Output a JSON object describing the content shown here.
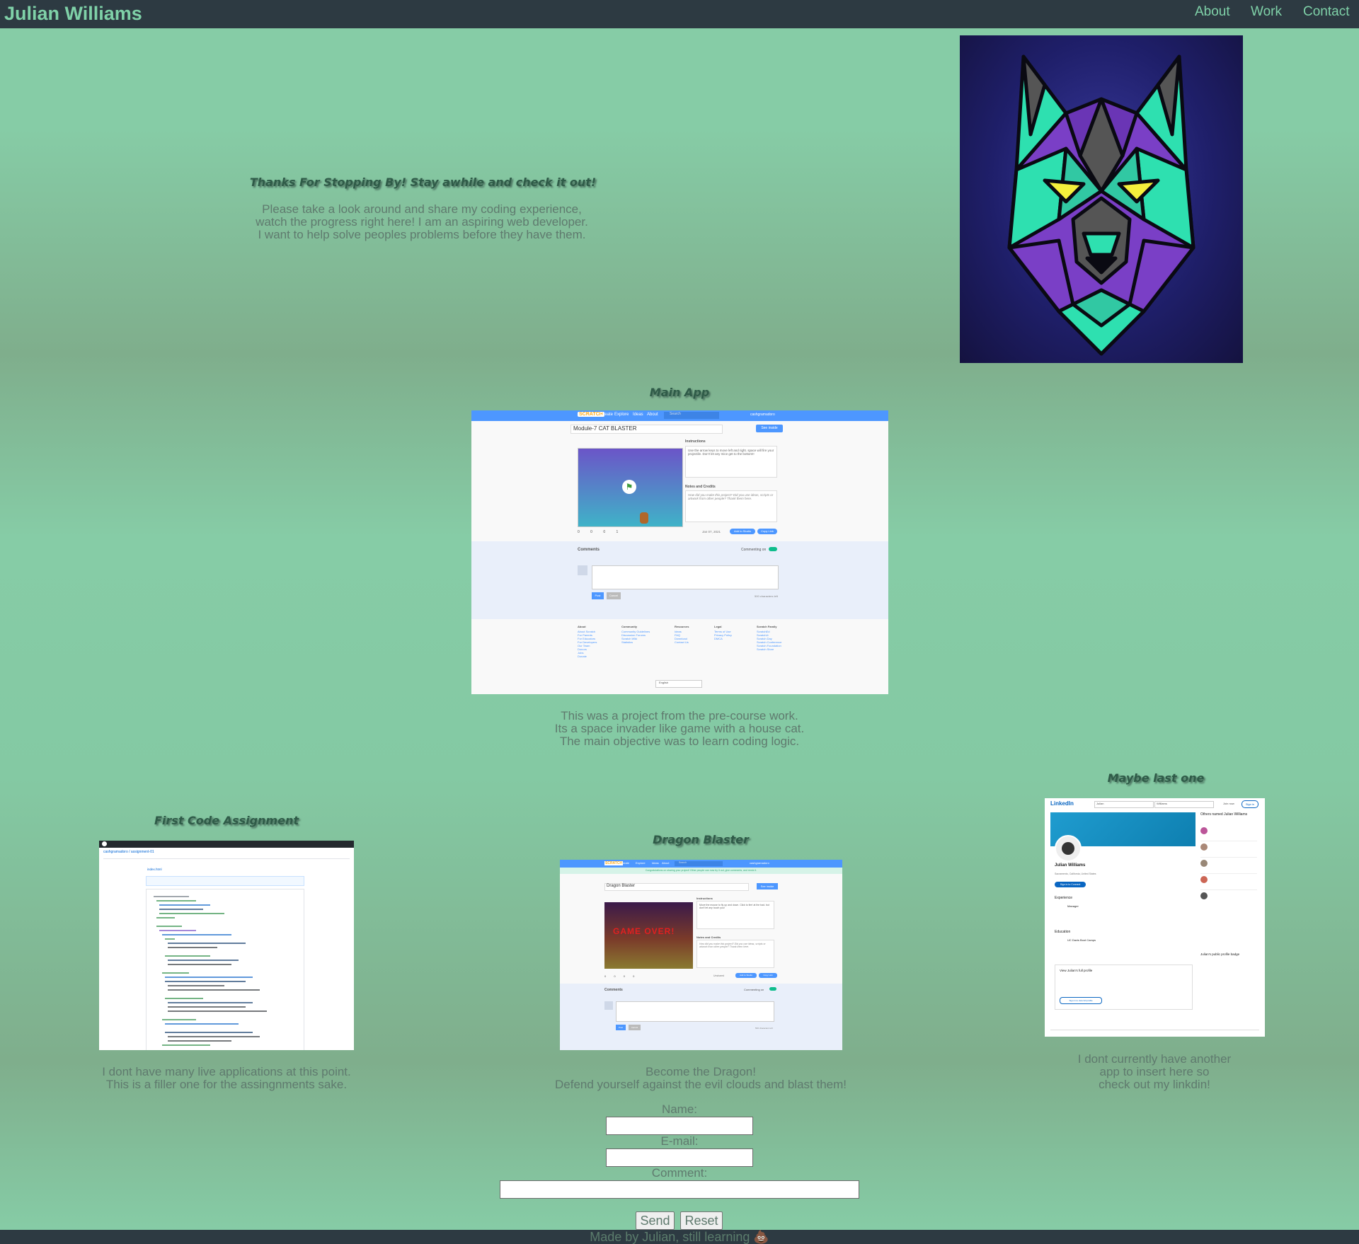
{
  "header": {
    "brand": "Julian Williams",
    "nav": [
      "About",
      "Work",
      "Contact"
    ]
  },
  "intro": {
    "heading": "Thanks For Stopping By! Stay awhile and check it out!",
    "lines": [
      "Please take a look around and share my coding experience,",
      "watch the progress right here! I am an aspiring web developer.",
      "I want to help solve peoples problems before they have them."
    ],
    "avatar_icon": "geometric-wolf-icon"
  },
  "main_app": {
    "heading": "Main App",
    "screenshot": {
      "brand": "SCRATCH",
      "menu": [
        "Create",
        "Explore",
        "Ideas",
        "About"
      ],
      "search_placeholder": "Search",
      "user": "cashgramadoro",
      "project_title": "Module-7 CAT BLASTER",
      "see_inside": "See inside",
      "instructions_label": "Instructions",
      "instructions_text": "Use the arrow keys to move left and right. space will fire your projectile. Don't let any mice get to the bottom!!",
      "notes_label": "Notes and Credits",
      "notes_text": "How did you make this project? Did you use ideas, scripts or artwork from other people? Thank them here.",
      "stats": [
        "0",
        "0",
        "0",
        "1"
      ],
      "date": "Jan 07, 2021",
      "add_to_studio": "Add to Studio",
      "copy_link": "Copy Link",
      "comments_label": "Comments",
      "commenting_on": "Commenting on",
      "post": "Post",
      "cancel": "Cancel",
      "chars_left": "500 characters left",
      "footer_cols": [
        {
          "title": "About",
          "items": [
            "About Scratch",
            "For Parents",
            "For Educators",
            "For Developers",
            "Our Team",
            "Donors",
            "Jobs",
            "Donate"
          ]
        },
        {
          "title": "Community",
          "items": [
            "Community Guidelines",
            "Discussion Forums",
            "Scratch Wiki",
            "Statistics"
          ]
        },
        {
          "title": "Resources",
          "items": [
            "Ideas",
            "FAQ",
            "Download",
            "Contact Us"
          ]
        },
        {
          "title": "Legal",
          "items": [
            "Terms of Use",
            "Privacy Policy",
            "DMCA"
          ]
        },
        {
          "title": "Scratch Family",
          "items": [
            "ScratchEd",
            "ScratchJr",
            "Scratch Day",
            "Scratch Conference",
            "Scratch Foundation",
            "Scratch Store"
          ]
        }
      ],
      "language": "English"
    },
    "lines": [
      "This was a project from the pre-course work.",
      "Its a space invader like game with a house cat.",
      "The main objective was to learn coding logic."
    ]
  },
  "first_code": {
    "heading": "First Code Assignment",
    "screenshot": {
      "repo": "cashgramadoro / assignment-01",
      "file": "index.html"
    },
    "lines": [
      "I dont have many live applications at this point.",
      "This is a filler one for the assingnments sake."
    ]
  },
  "dragon": {
    "heading": "Dragon Blaster",
    "screenshot": {
      "brand": "SCRATCH",
      "menu": [
        "Create",
        "Explore",
        "Ideas",
        "About"
      ],
      "search_placeholder": "Search",
      "user": "cashgramadoro",
      "notice": "Congratulations on sharing your project! Other people can now try it out, give comments, and remix it.",
      "project_title": "Dragon Blaster",
      "see_inside": "See inside",
      "instructions_label": "Instructions",
      "instructions_text": "Move the mouse to fly up and down. Click to fire! at the bad. but don't let any touch you!",
      "notes_label": "Notes and Credits",
      "notes_text": "How did you make this project? Did you use ideas, scripts or artwork from other people? Thank them here.",
      "game_over": "GAME OVER!",
      "stats": [
        "0",
        "0",
        "0",
        "0"
      ],
      "unshared": "Unshared",
      "add_to_studio": "Add to Studio",
      "copy_link": "Copy Link",
      "comments_label": "Comments",
      "commenting_on": "Commenting on",
      "post": "Post",
      "cancel": "Cancel",
      "chars_left": "500 characters left"
    },
    "lines": [
      "Become the Dragon!",
      "Defend yourself against the evil clouds and blast them!"
    ]
  },
  "linkedin": {
    "heading": "Maybe last one",
    "screenshot": {
      "logo": "LinkedIn",
      "search_first": "Julian",
      "search_last": "Williams",
      "join": "Join now",
      "signin": "Sign in",
      "name": "Julian Williams",
      "location": "Sacramento, California, United States",
      "connect": "Sign in to Connect",
      "exp_label": "Experience",
      "exp_title": "Manager",
      "edu_label": "Education",
      "edu_school": "UC Davis Boot Camps",
      "others_label": "Others named Julian Williams",
      "view_profile": "View Julian's full profile",
      "badge_label": "Julian's public profile badge",
      "sign_in_full": "Sign in to view full profile"
    },
    "lines": [
      "I dont currently have another",
      "app to insert here so",
      "check out my linkdin!"
    ]
  },
  "contact_form": {
    "name_label": "Name:",
    "email_label": "E-mail:",
    "comment_label": "Comment:",
    "send": "Send",
    "reset": "Reset"
  },
  "footer": {
    "text": "Made by Julian, still learning 💩"
  }
}
